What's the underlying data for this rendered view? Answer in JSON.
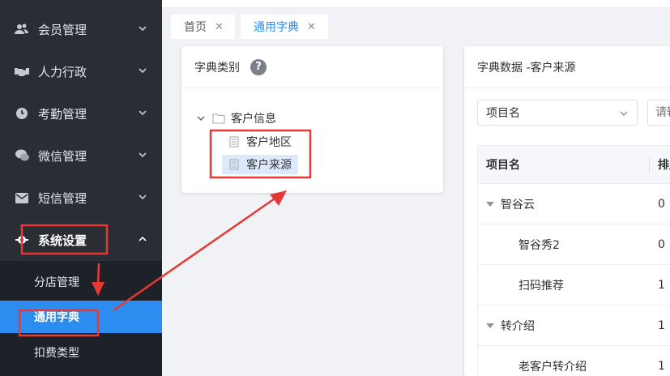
{
  "sidebar": {
    "items": [
      {
        "label": "会员管理",
        "icon": "users-icon"
      },
      {
        "label": "人力行政",
        "icon": "handshake-icon"
      },
      {
        "label": "考勤管理",
        "icon": "clock-icon"
      },
      {
        "label": "微信管理",
        "icon": "chat-bubble-icon"
      },
      {
        "label": "短信管理",
        "icon": "envelope-icon"
      },
      {
        "label": "系统设置",
        "icon": "gear-icon"
      }
    ],
    "submenu": [
      "分店管理",
      "通用字典",
      "扣费类型"
    ]
  },
  "tabs": [
    {
      "label": "首页"
    },
    {
      "label": "通用字典"
    }
  ],
  "left_panel": {
    "title": "字典类别",
    "help": "?",
    "tree": {
      "root": "客户信息",
      "children": [
        "客户地区",
        "客户来源"
      ]
    }
  },
  "right_panel": {
    "title": "字典数据 -客户来源",
    "filter_select": "项目名",
    "search_placeholder": "请输",
    "columns": [
      "项目名",
      "排序"
    ],
    "rows": [
      {
        "name": "智谷云",
        "order": "0"
      },
      {
        "name": "智谷秀2",
        "order": "0"
      },
      {
        "name": "扫码推荐",
        "order": "1"
      },
      {
        "name": "转介绍",
        "order": "1"
      },
      {
        "name": "老客户转介绍",
        "order": "1"
      }
    ]
  },
  "colors": {
    "sidebar_bg": "#2b2d35",
    "submenu_bg": "#1f2128",
    "accent": "#2d8cf0",
    "annotation": "#e53935"
  }
}
